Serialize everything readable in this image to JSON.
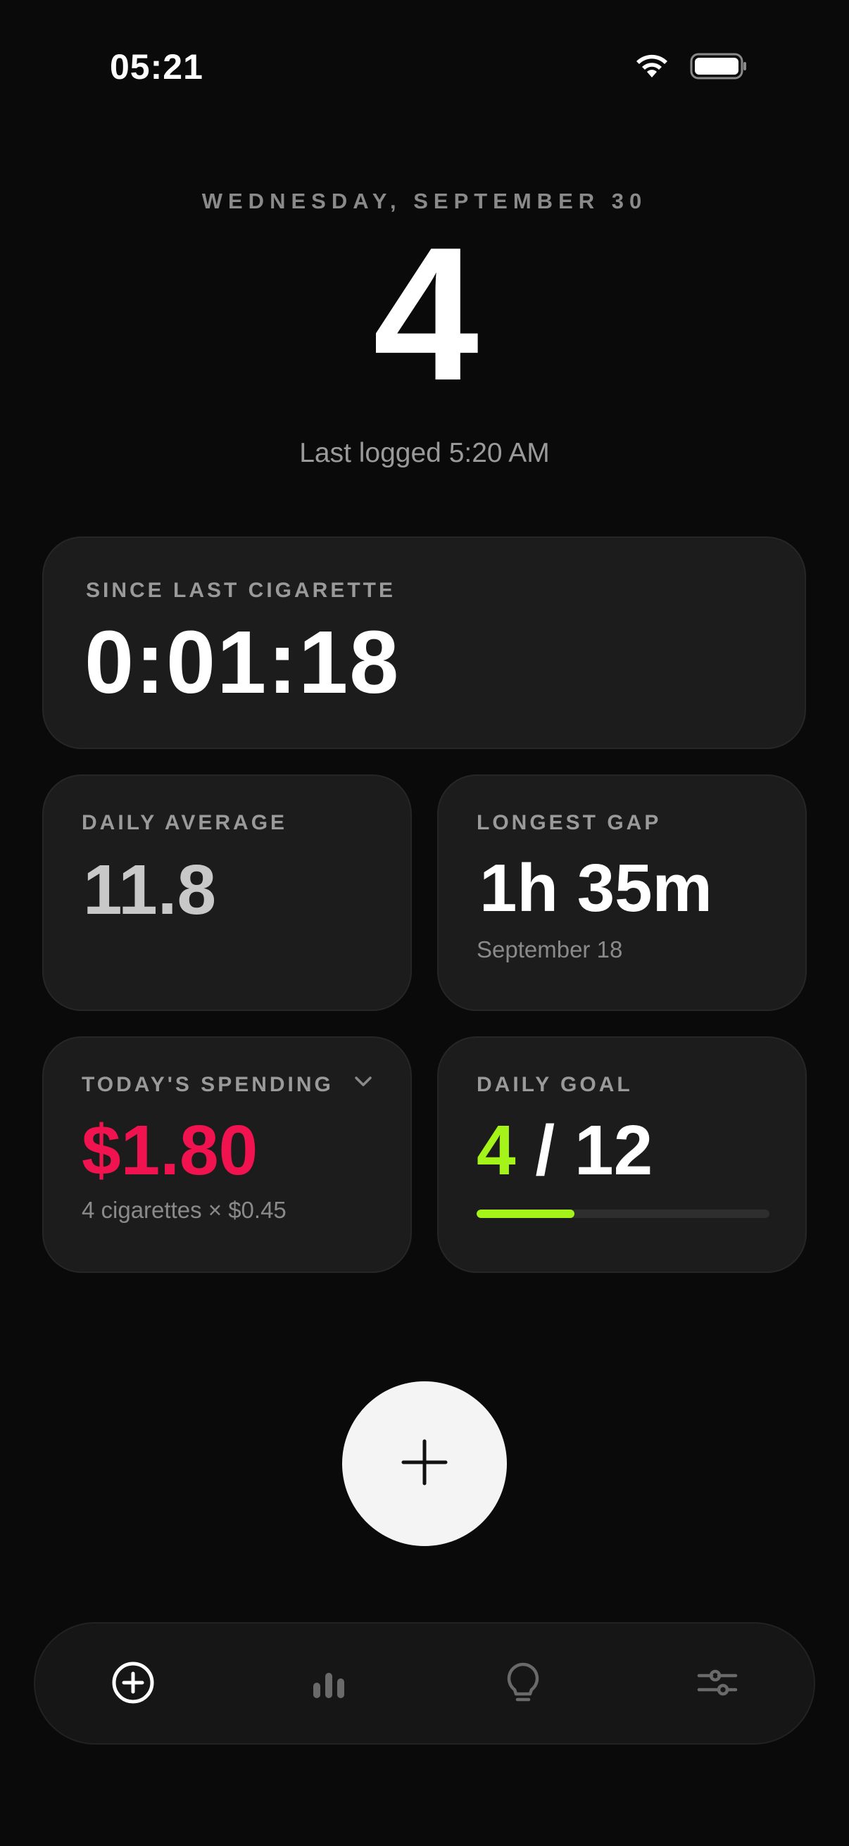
{
  "status_bar": {
    "time": "05:21"
  },
  "header": {
    "date": "WEDNESDAY, SEPTEMBER 30",
    "count": "4",
    "last_logged": "Last logged 5:20 AM"
  },
  "since_last": {
    "label": "SINCE LAST CIGARETTE",
    "value": "0:01:18"
  },
  "daily_average": {
    "label": "DAILY AVERAGE",
    "value": "11.8"
  },
  "longest_gap": {
    "label": "LONGEST GAP",
    "value": "1h 35m",
    "date": "September 18"
  },
  "spending": {
    "label": "TODAY'S SPENDING",
    "value": "$1.80",
    "detail": "4 cigarettes × $0.45",
    "value_color": "#f0134f"
  },
  "daily_goal": {
    "label": "DAILY GOAL",
    "current": "4",
    "separator": "/",
    "total": "12",
    "progress": 0.333,
    "accent_color": "#a4f41a"
  },
  "add_button": {
    "icon": "plus-icon"
  },
  "tab_bar": {
    "tabs": [
      {
        "id": "log",
        "icon": "plus-circle-icon",
        "active": true
      },
      {
        "id": "stats",
        "icon": "bar-chart-icon",
        "active": false
      },
      {
        "id": "tips",
        "icon": "lightbulb-icon",
        "active": false
      },
      {
        "id": "settings",
        "icon": "sliders-icon",
        "active": false
      }
    ]
  }
}
